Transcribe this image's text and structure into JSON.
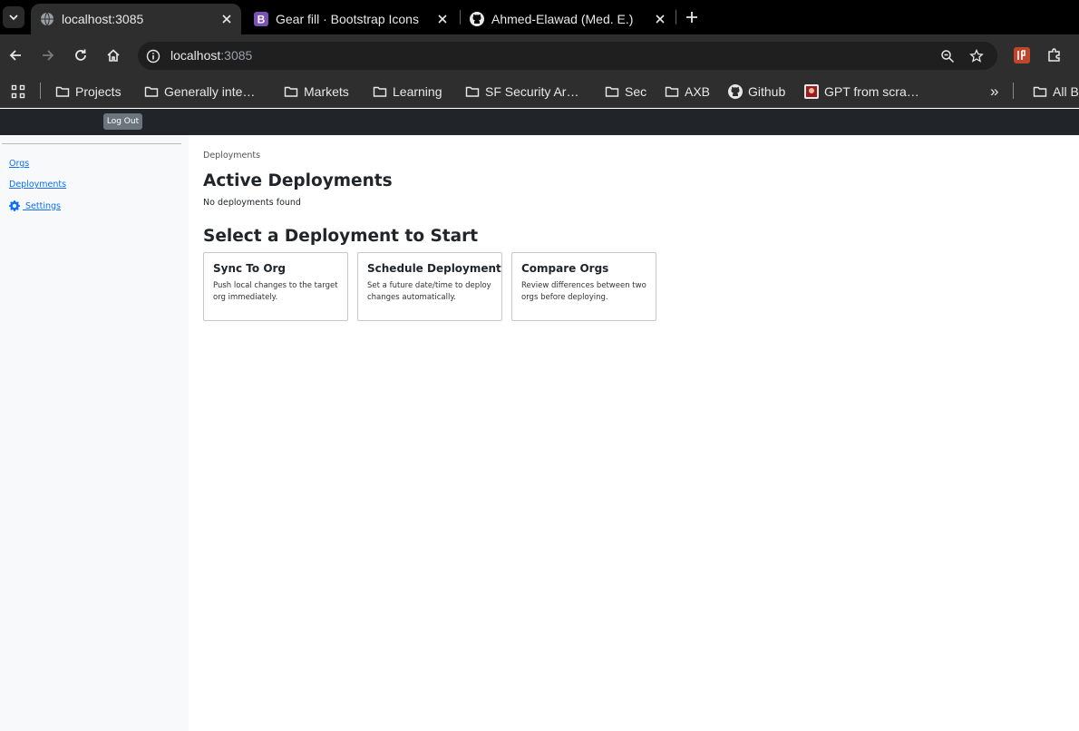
{
  "browser": {
    "tabs": [
      {
        "title": "localhost:3085",
        "active": true
      },
      {
        "title": "Gear fill · Bootstrap Icons",
        "active": false
      },
      {
        "title": "Ahmed-Elawad (Med. E.)",
        "active": false
      }
    ],
    "new_tab_label": "+",
    "address": {
      "host": "localhost",
      "port": ":3085"
    },
    "bookmarks": [
      {
        "label": "Projects",
        "icon": "folder-icon"
      },
      {
        "label": "Generally inte…",
        "icon": "folder-icon"
      },
      {
        "label": "Markets",
        "icon": "folder-icon"
      },
      {
        "label": "Learning",
        "icon": "folder-icon"
      },
      {
        "label": "SF Security Ar…",
        "icon": "folder-icon"
      },
      {
        "label": "Sec",
        "icon": "folder-icon"
      },
      {
        "label": "AXB",
        "icon": "folder-icon"
      },
      {
        "label": "Github",
        "icon": "github-icon"
      },
      {
        "label": "GPT from scra…",
        "icon": "site-icon"
      }
    ],
    "overflow_label": "»",
    "all_bookmarks_label": "All B"
  },
  "app": {
    "header": {
      "logout_label": "Log Out"
    },
    "sidebar": {
      "items": [
        {
          "label": "Orgs"
        },
        {
          "label": "Deployments"
        },
        {
          "label": " Settings",
          "icon": "gear-fill-icon"
        }
      ]
    },
    "breadcrumb": "Deployments",
    "active_heading": "Active Deployments",
    "empty_message": "No deployments found",
    "select_heading": "Select a Deployment to Start",
    "cards": [
      {
        "title": "Sync To Org",
        "desc_line1": "Push local changes to the target",
        "desc_line2": "org immediately."
      },
      {
        "title": "Schedule Deployment",
        "desc_line1": "Set a future date/time to deploy",
        "desc_line2": "changes automatically."
      },
      {
        "title": "Compare Orgs",
        "desc_line1": "Review differences between two",
        "desc_line2": "orgs before deploying."
      }
    ]
  },
  "colors": {
    "link": "#0d6efd",
    "header_bg": "#212529",
    "sidebar_bg": "#f8f9fa",
    "logout_bg": "#6c757d"
  }
}
